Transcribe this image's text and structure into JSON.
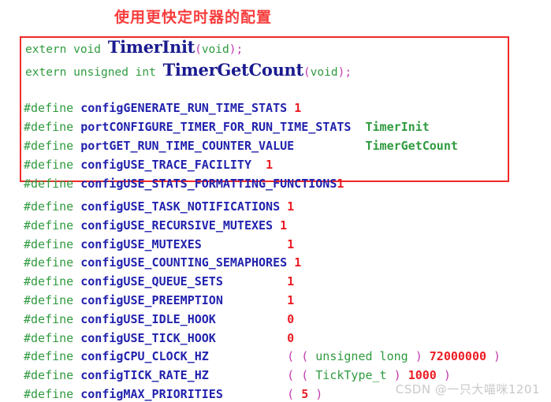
{
  "title": "使用更快定时器的配置",
  "watermark": "CSDN @一只大喵咪1201",
  "colors": {
    "title_red": "#f83d3d",
    "box_border_red": "#f02a2a",
    "keyword_green": "#2f9b3f",
    "macro_blue": "#2222ae",
    "number_red": "#ec1c24",
    "paren_magenta": "#c43bb0",
    "watermark_gray": "#c9c9c9"
  },
  "code_box": {
    "prototypes": [
      {
        "kw": "extern void ",
        "fn": "TimerInit",
        "open": "(",
        "arg": "void",
        "close": ")",
        "semi": ";"
      },
      {
        "kw": "extern unsigned int ",
        "fn": "TimerGetCount",
        "open": "(",
        "arg": "void",
        "close": ")",
        "semi": ";"
      }
    ],
    "defines": [
      {
        "pp": "#define",
        "macro": "configGENERATE_RUN_TIME_STATS",
        "gap": " ",
        "value": "1",
        "value_type": "number"
      },
      {
        "pp": "#define",
        "macro": "portCONFIGURE_TIMER_FOR_RUN_TIME_STATS",
        "gap": "  ",
        "value": "TimerInit",
        "value_type": "identifier"
      },
      {
        "pp": "#define",
        "macro": "portGET_RUN_TIME_COUNTER_VALUE",
        "gap": "          ",
        "value": "TimerGetCount",
        "value_type": "identifier"
      },
      {
        "pp": "#define",
        "macro": "configUSE_TRACE_FACILITY",
        "gap": "  ",
        "value": "1",
        "value_type": "number"
      },
      {
        "pp": "#define",
        "macro": "configUSE_STATS_FORMATTING_FUNCTIONS",
        "gap": "",
        "value": "1",
        "value_type": "number"
      }
    ]
  },
  "defines_block": [
    {
      "pp": "#define",
      "macro": "configUSE_TASK_NOTIFICATIONS",
      "gap": " ",
      "value": "1",
      "value_type": "number"
    },
    {
      "pp": "#define",
      "macro": "configUSE_RECURSIVE_MUTEXES",
      "gap": " ",
      "value": "1",
      "value_type": "number"
    },
    {
      "pp": "#define",
      "macro": "configUSE_MUTEXES",
      "gap": "            ",
      "value": "1",
      "value_type": "number"
    },
    {
      "pp": "#define",
      "macro": "configUSE_COUNTING_SEMAPHORES",
      "gap": " ",
      "value": "1",
      "value_type": "number"
    },
    {
      "pp": "#define",
      "macro": "configUSE_QUEUE_SETS",
      "gap": "         ",
      "value": "1",
      "value_type": "number"
    },
    {
      "pp": "#define",
      "macro": "configUSE_PREEMPTION",
      "gap": "         ",
      "value": "1",
      "value_type": "number"
    },
    {
      "pp": "#define",
      "macro": "configUSE_IDLE_HOOK",
      "gap": "          ",
      "value": "0",
      "value_type": "number"
    },
    {
      "pp": "#define",
      "macro": "configUSE_TICK_HOOK",
      "gap": "          ",
      "value": "0",
      "value_type": "number"
    },
    {
      "pp": "#define",
      "macro": "configCPU_CLOCK_HZ",
      "gap": "           ",
      "value_type": "expr",
      "expr": [
        {
          "t": "( ( ",
          "c": "paren"
        },
        {
          "t": "unsigned long",
          "c": "kw"
        },
        {
          "t": " ) ",
          "c": "paren"
        },
        {
          "t": "72000000",
          "c": "num"
        },
        {
          "t": " )",
          "c": "paren"
        }
      ]
    },
    {
      "pp": "#define",
      "macro": "configTICK_RATE_HZ",
      "gap": "           ",
      "value_type": "expr",
      "expr": [
        {
          "t": "( ( ",
          "c": "paren"
        },
        {
          "t": "TickType_t",
          "c": "kw"
        },
        {
          "t": " ) ",
          "c": "paren"
        },
        {
          "t": "1000",
          "c": "num"
        },
        {
          "t": " )",
          "c": "paren"
        }
      ]
    },
    {
      "pp": "#define",
      "macro": "configMAX_PRIORITIES",
      "gap": "         ",
      "value_type": "expr",
      "expr": [
        {
          "t": "( ",
          "c": "paren"
        },
        {
          "t": "5",
          "c": "num"
        },
        {
          "t": " )",
          "c": "paren"
        }
      ]
    }
  ]
}
